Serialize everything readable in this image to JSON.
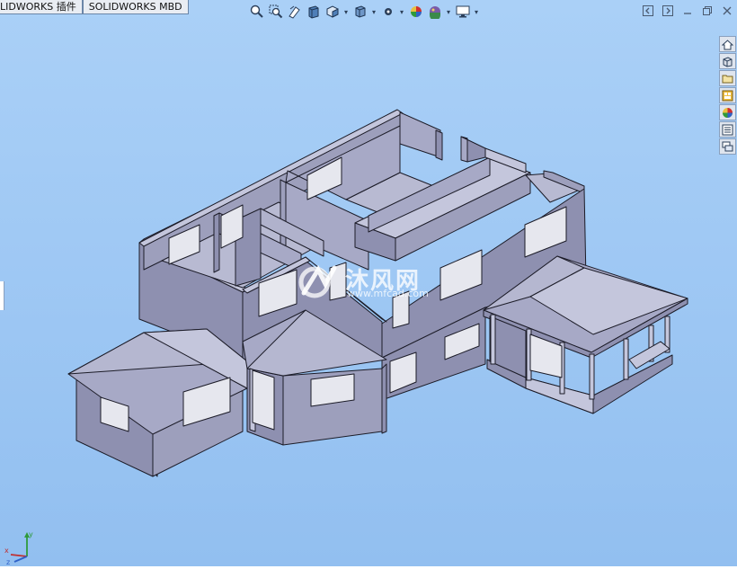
{
  "command_tabs": [
    "LIDWORKS 插件",
    "SOLIDWORKS MBD"
  ],
  "heads_up_toolbar": {
    "icons": [
      "zoom-to-fit-icon",
      "zoom-to-area-icon",
      "previous-view-icon",
      "section-view-icon",
      "view-orientation-icon",
      "display-style-icon",
      "hide-show-items-icon",
      "edit-appearance-icon",
      "apply-scene-icon",
      "view-settings-icon"
    ]
  },
  "window_controls": [
    "tile-left-icon",
    "tile-right-icon",
    "minimize-icon",
    "restore-icon",
    "close-icon"
  ],
  "task_pane": {
    "icons": [
      "solidworks-resources-icon",
      "design-library-icon",
      "file-explorer-icon",
      "view-palette-icon",
      "appearances-icon",
      "custom-properties-icon",
      "forum-icon"
    ]
  },
  "watermark": {
    "text": "沐风网",
    "url": "www.mfcad.com"
  },
  "triad": {
    "x_label": "x",
    "y_label": "y",
    "z_label": "z"
  },
  "colors": {
    "background_top": "#a9cef6",
    "background_bottom": "#93bff0",
    "model_light": "#a7a9c6",
    "model_mid": "#8e90b0",
    "model_dark": "#6f7192",
    "edge": "#1c1c28"
  }
}
